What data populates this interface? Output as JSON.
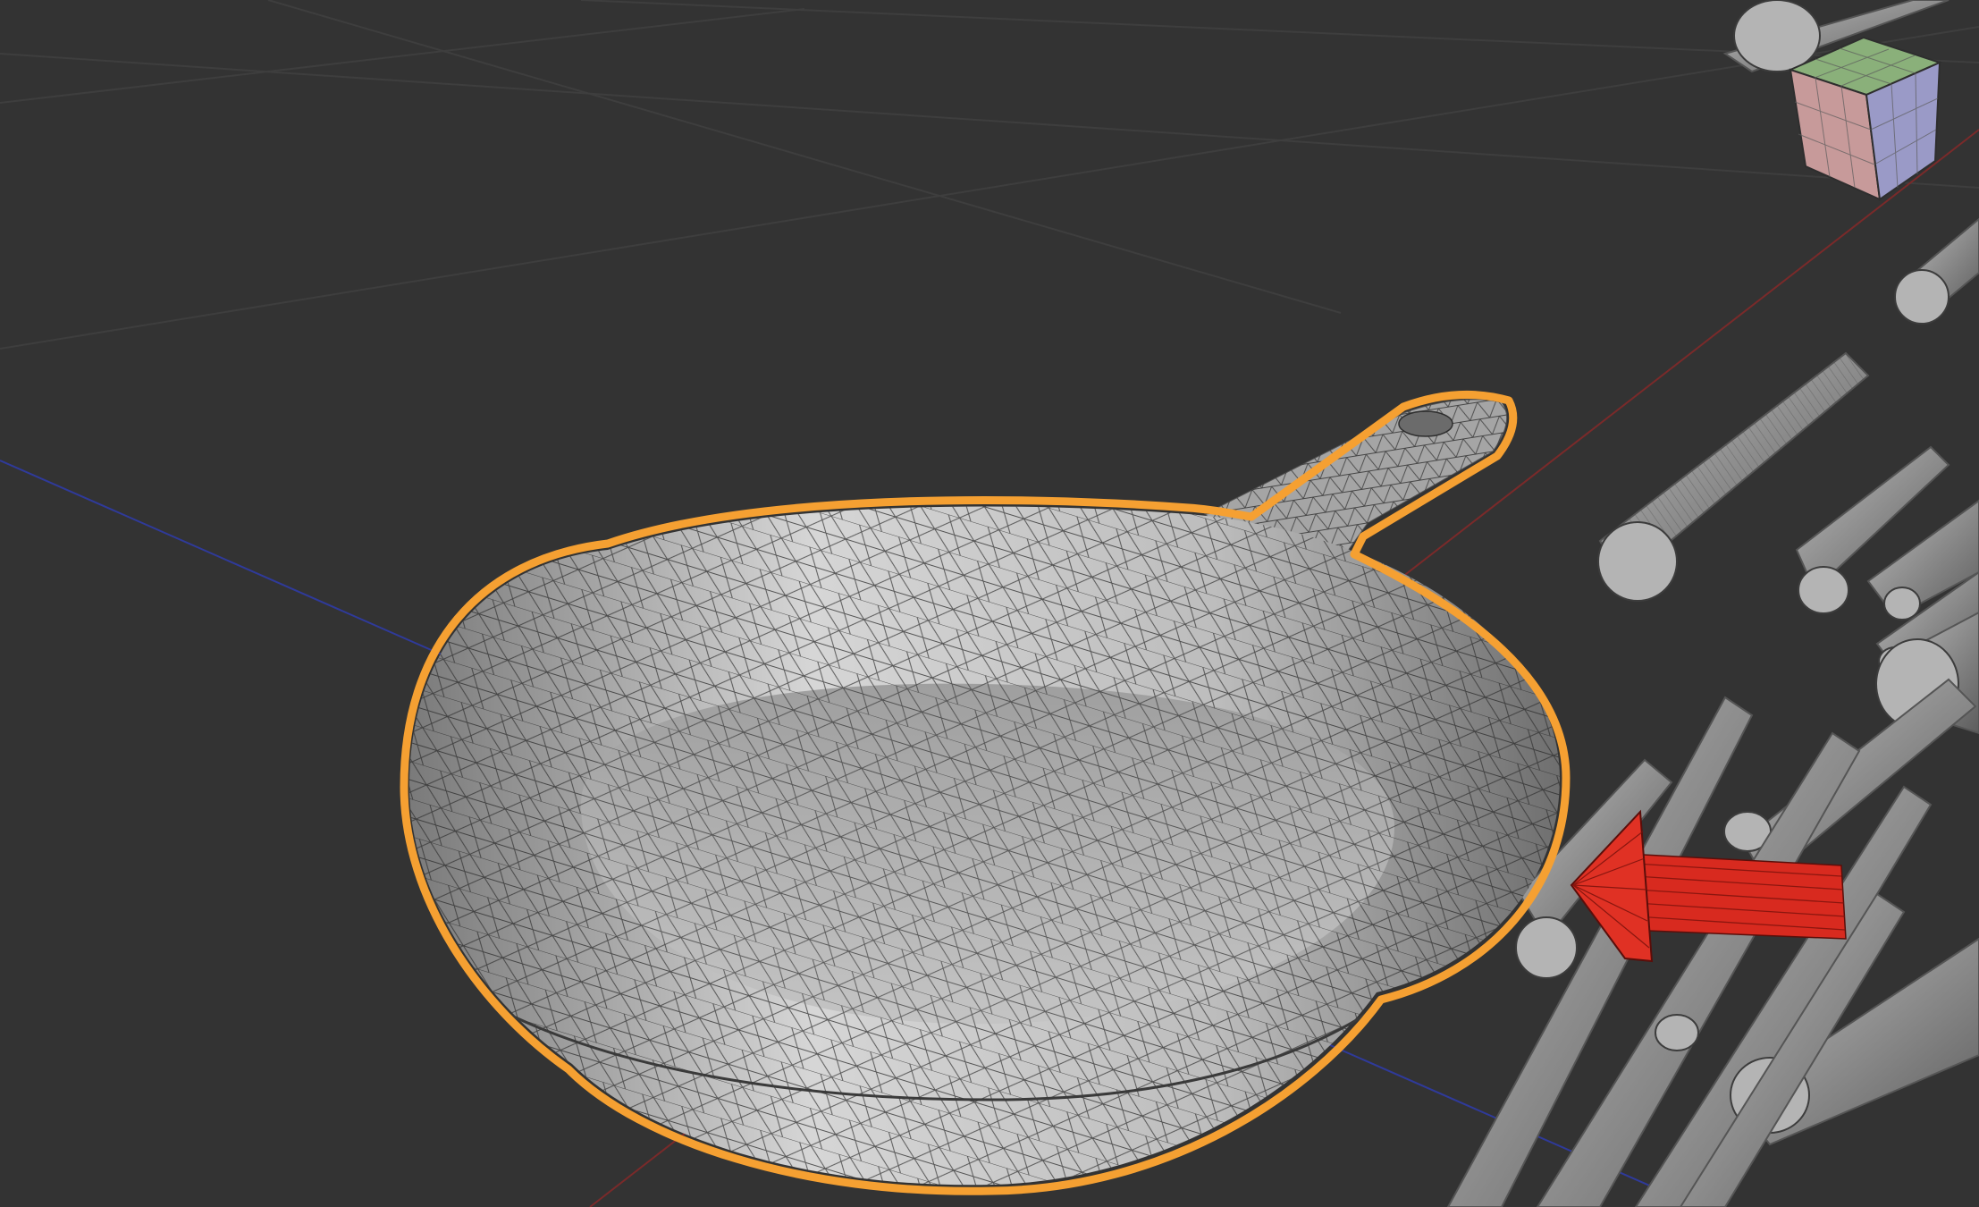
{
  "viewport": {
    "background_color": "#333333",
    "selection_outline_color": "#f5a032",
    "x_axis_color": "#7a2a2a",
    "y_axis_color": "#2f3a9a",
    "grid_color": "#3e3e3e",
    "mesh_fill_color": "#b8b8b8",
    "arrow_color": "#d82a1f"
  },
  "objects": {
    "selected": "frying-pan-mesh",
    "others": [
      "cylinder-pipes",
      "light-arrow"
    ]
  },
  "navigation_gizmo": {
    "icon": "view-cube-icon",
    "face_colors": {
      "top": "#8ab07a",
      "left": "#c79a9a",
      "right": "#9a9ac7"
    }
  }
}
